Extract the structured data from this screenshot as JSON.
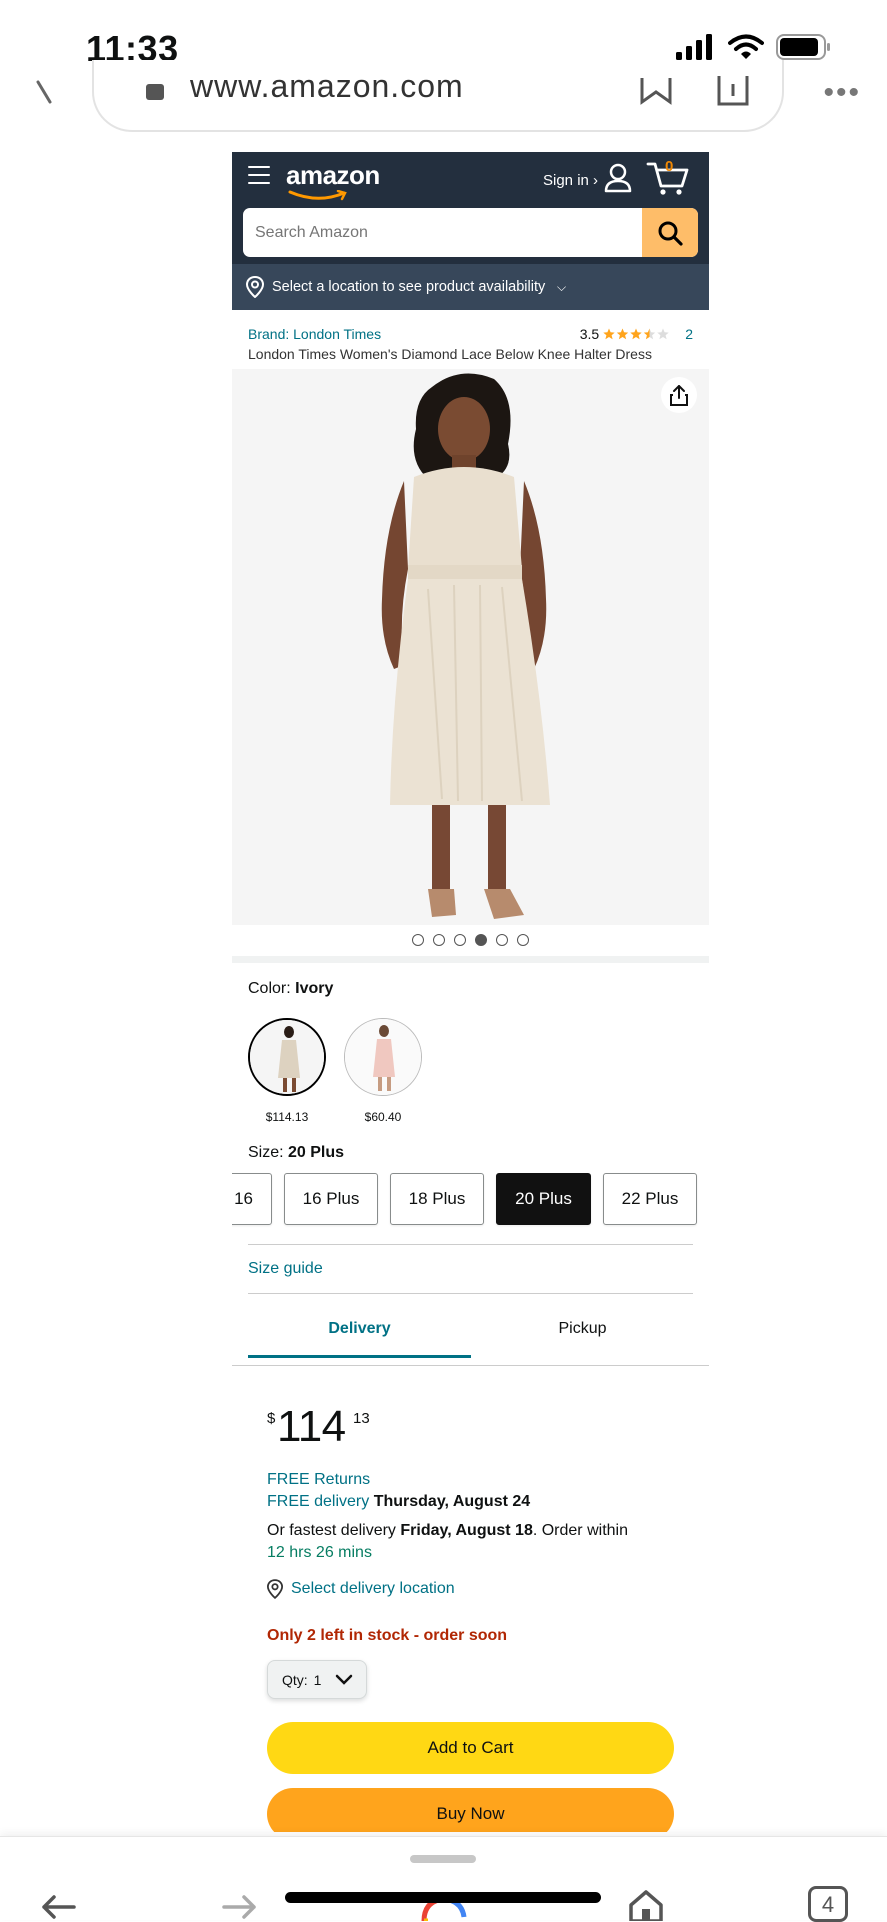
{
  "status_bar": {
    "time": "11:33"
  },
  "browser": {
    "url": "www.amazon.com",
    "tab_count": "4"
  },
  "header": {
    "logo": "amazon",
    "signin": "Sign in ›",
    "cart_count": "0",
    "search_placeholder": "Search Amazon",
    "location_prompt": "Select a location to see product availability",
    "location_caret": "⌵"
  },
  "product": {
    "brand": "Brand: London Times",
    "rating": "3.5",
    "rating_count": "2",
    "stars_filled": 3.5,
    "title": "London Times Women's Diamond Lace Below Knee Halter Dress",
    "image_count": 6,
    "active_image_index": 3
  },
  "color": {
    "label": "Color: ",
    "selected": "Ivory",
    "options": [
      {
        "price": "$114.13"
      },
      {
        "price": "$60.40"
      }
    ]
  },
  "size": {
    "label": "Size: ",
    "selected": "20 Plus",
    "options": [
      "16",
      "16 Plus",
      "18 Plus",
      "20 Plus",
      "22 Plus"
    ],
    "guide": "Size guide"
  },
  "tabs": [
    "Delivery",
    "Pickup"
  ],
  "offer": {
    "price_symbol": "$",
    "price_whole": "114",
    "price_fraction": "13",
    "free_returns": "FREE Returns",
    "free_delivery_prefix": "FREE delivery",
    "delivery_date": "Thursday, August 24",
    "fastest_prefix": "Or fastest delivery ",
    "fastest_date": "Friday, August 18",
    "order_within": ". Order within",
    "countdown": "12 hrs 26 mins",
    "select_location": "Select delivery location",
    "stock": "Only 2 left in stock - order soon",
    "qty_label": "Qty:",
    "qty_value": "1",
    "add_to_cart": "Add to Cart",
    "buy_now": "Buy Now"
  },
  "colors": {
    "nav": "#232f3e",
    "location_bar": "#37475a",
    "search_button": "#febd69",
    "link": "#007185",
    "stock": "#b12704",
    "countdown": "#067d62",
    "add_to_cart": "#ffd814",
    "buy_now": "#ffa41c",
    "star": "#ffa41c"
  }
}
